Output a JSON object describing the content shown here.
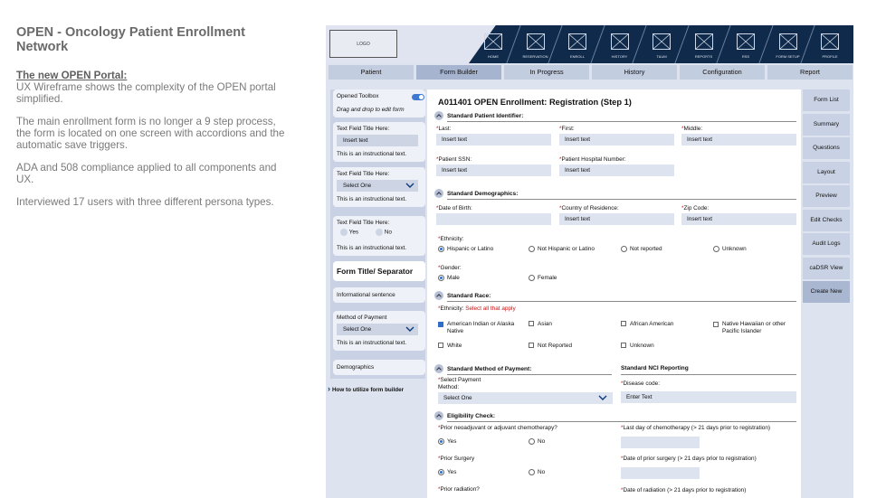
{
  "description": {
    "title": "OPEN - Oncology Patient Enrollment Network",
    "portal_heading": "The new OPEN Portal:",
    "portal_text": "UX Wireframe shows the complexity of the OPEN portal simplified.",
    "para2": "The main enrollment form is no longer a 9 step process, the form is located on one screen with accordions and the automatic save triggers.",
    "para3": "ADA and 508 compliance applied to all components and UX.",
    "para4": "Interviewed 17 users with three different persona types."
  },
  "header": {
    "logo": "LOGO",
    "nav": [
      {
        "label": "HOME",
        "icon": "home-icon"
      },
      {
        "label": "RESERVATION",
        "icon": "reservation-icon"
      },
      {
        "label": "ENROLL",
        "icon": "enroll-icon"
      },
      {
        "label": "HISTORY",
        "icon": "history-icon"
      },
      {
        "label": "T&UM",
        "icon": "tum-icon"
      },
      {
        "label": "REPORTS",
        "icon": "reports-icon"
      },
      {
        "label": "RSS",
        "icon": "rss-icon"
      },
      {
        "label": "FORM SETUP",
        "icon": "form-setup-icon"
      },
      {
        "label": "PROFILE",
        "icon": "profile-icon"
      }
    ],
    "tabs": [
      "Patient",
      "Form Builder",
      "In Progress",
      "History",
      "Configuration",
      "Report"
    ],
    "active_tab": "Form Builder"
  },
  "toolbox": {
    "opened_label": "Opened Toolbox",
    "drag_text": "Drag and drop to edit form",
    "field1_title": "Text Field Title Here:",
    "field1_value": "Insert text",
    "field1_help": "This is an instructional text.",
    "field2_title": "Text Field Title Here:",
    "field2_value": "Select One",
    "field2_help": "This is an instructional text.",
    "field3_title": "Text Field Title Here:",
    "field3_yes": "Yes",
    "field3_no": "No",
    "field3_help": "This is an instructional text.",
    "separator": "Form Title/ Separator",
    "informational": "Informational sentence",
    "payment_title": "Method of Payment",
    "payment_value": "Select One",
    "payment_help": "This is an instructional text.",
    "demographics": "Demographics",
    "howto": "How to utilize form builder"
  },
  "form": {
    "title": "A011401 OPEN Enrollment: Registration (Step 1)",
    "identifier": {
      "heading": "Standard Patient Identifier:",
      "last_label": "Last:",
      "first_label": "First:",
      "middle_label": "Middle:",
      "placeholder": "Insert text",
      "ssn_label": "Patient SSN:",
      "hospital_label": "Patient Hospital Number:"
    },
    "demographics": {
      "heading": "Standard Demographics:",
      "dob_label": "Date of Birth:",
      "country_label": "Country of Residence:",
      "zip_label": "Zip Code:",
      "placeholder": "Insert text",
      "ethnicity_label": "Ethnicity:",
      "ethnicity_options": [
        "Hispanic or Latino",
        "Not Hispanic or Latino",
        "Not reported",
        "Unknown"
      ],
      "gender_label": "Gender:",
      "gender_options": [
        "Male",
        "Female"
      ]
    },
    "race": {
      "heading": "Standard Race:",
      "label": "Ethnicity:",
      "hint": "Select all that apply",
      "options": [
        "American Indian or Alaska Native",
        "Asian",
        "African American",
        "Native Hawaiian or other Pacific Islander",
        "White",
        "Not Reported",
        "Unknown"
      ]
    },
    "payment": {
      "heading": "Standard Method of Payment:",
      "label": "Select Payment Method:",
      "value": "Select One"
    },
    "nci": {
      "heading": "Standard NCI Reporting",
      "disease_label": "Disease code:",
      "disease_value": "Enter Text"
    },
    "eligibility": {
      "heading": "Eligibility Check:",
      "q1": "Prior neoadjuvant or adjuvant chemotherapy?",
      "q1_date": "Last day of chemotherapy (> 21 days prior to registration)",
      "q2": "Prior Surgery",
      "q2_date": "Date of prior surgery (> 21 days prior to registration)",
      "q3": "Prior radiation?",
      "q3_date": "Date of radiation (> 21 days prior to registration)",
      "yes": "Yes",
      "no": "No"
    }
  },
  "side_buttons": [
    "Form List",
    "Summary",
    "Questions",
    "Layout",
    "Preview",
    "Edit Checks",
    "Audit Logs",
    "caDSR View",
    "Create New"
  ]
}
